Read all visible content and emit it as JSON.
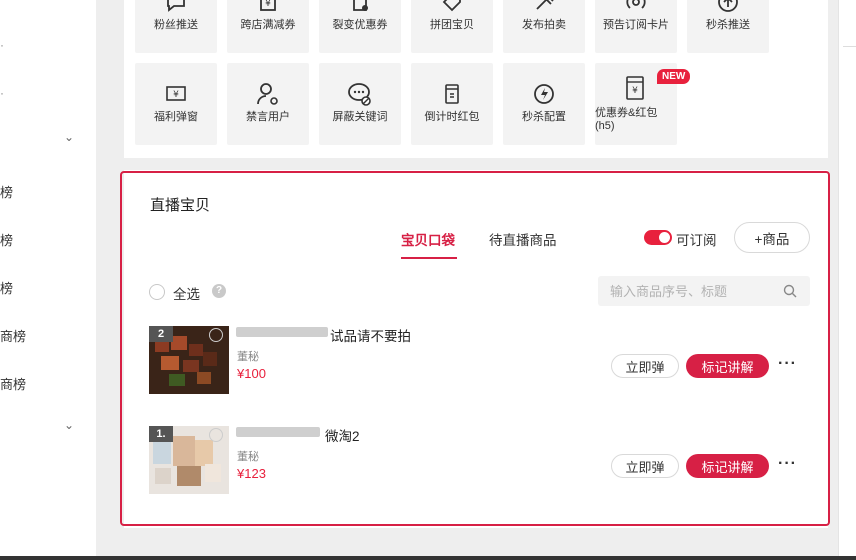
{
  "sidebar": {
    "items": [
      {
        "label": "榜"
      },
      {
        "label": "榜"
      },
      {
        "label": "榜"
      },
      {
        "label": "商榜"
      },
      {
        "label": "商榜"
      }
    ]
  },
  "tools": {
    "row1": [
      {
        "label": "粉丝推送",
        "icon": "chat-bubble-icon"
      },
      {
        "label": "跨店满减券",
        "icon": "coupon-icon"
      },
      {
        "label": "裂变优惠券",
        "icon": "fission-coupon-icon"
      },
      {
        "label": "拼团宝贝",
        "icon": "tag-icon"
      },
      {
        "label": "发布拍卖",
        "icon": "gavel-icon"
      },
      {
        "label": "预告订阅卡片",
        "icon": "broadcast-icon"
      },
      {
        "label": "秒杀推送",
        "icon": "upload-arrow-icon"
      }
    ],
    "row2": [
      {
        "label": "福利弹窗",
        "icon": "popup-yen-icon"
      },
      {
        "label": "禁言用户",
        "icon": "mute-user-icon"
      },
      {
        "label": "屏蔽关键词",
        "icon": "block-keyword-icon"
      },
      {
        "label": "倒计时红包",
        "icon": "countdown-envelope-icon"
      },
      {
        "label": "秒杀配置",
        "icon": "lightning-icon"
      },
      {
        "label": "优惠券&红包(h5)",
        "icon": "envelope-yen-icon",
        "badge": "NEW"
      }
    ]
  },
  "live_items": {
    "title": "直播宝贝",
    "tabs": [
      {
        "label": "宝贝口袋",
        "active": true
      },
      {
        "label": "待直播商品",
        "active": false
      }
    ],
    "subscribe_toggle": {
      "label": "可订阅",
      "on": true
    },
    "add_button": "+商品",
    "select_all": "全选",
    "search": {
      "placeholder": "输入商品序号、标题",
      "value": ""
    },
    "products": [
      {
        "index": "2",
        "title": "试品请不要拍",
        "subtitle": "董秘",
        "price": "¥100",
        "pop_label": "立即弹",
        "mark_label": "标记讲解"
      },
      {
        "index": "1.",
        "title": "微淘2",
        "subtitle": "董秘",
        "price": "¥123",
        "pop_label": "立即弹",
        "mark_label": "标记讲解"
      }
    ]
  },
  "colors": {
    "accent": "#d72045",
    "badge": "#e8213d",
    "price": "#e8213d"
  }
}
